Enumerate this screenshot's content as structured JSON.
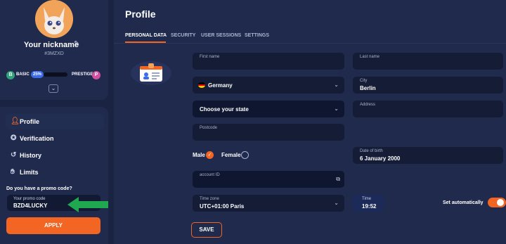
{
  "sidebar": {
    "nickname": "Your nickname",
    "user_id": "#3MZXD",
    "level": {
      "current_badge": "B",
      "current": "BASIC",
      "progress_label": "25%",
      "progress": 0.25,
      "next": "PRESTIGE",
      "next_badge": "P"
    },
    "nav": [
      {
        "label": "Profile",
        "icon": "user-icon",
        "active": true
      },
      {
        "label": "Verification",
        "icon": "verified-icon",
        "active": false
      },
      {
        "label": "History",
        "icon": "history-icon",
        "active": false
      },
      {
        "label": "Limits",
        "icon": "hand-icon",
        "active": false
      }
    ],
    "promo": {
      "question": "Do you have a promo code?",
      "label": "Your promo code",
      "value": "BZD4LUCKY",
      "apply_label": "APPLY"
    }
  },
  "main": {
    "title": "Profile",
    "tabs": [
      {
        "label": "PERSONAL DATA",
        "active": true
      },
      {
        "label": "SECURITY",
        "active": false
      },
      {
        "label": "USER SESSIONS",
        "active": false
      },
      {
        "label": "SETTINGS",
        "active": false
      }
    ],
    "form": {
      "first_name_label": "First name",
      "first_name": "",
      "last_name_label": "Last name",
      "last_name": "",
      "country": "Germany",
      "city_label": "City",
      "city": "Berlin",
      "state_placeholder": "Choose your state",
      "address_label": "Address",
      "address": "",
      "postcode_label": "Postcode",
      "postcode": "",
      "gender_male": "Male",
      "gender_female": "Female",
      "gender_selected": "Male",
      "dob_label": "Date of birth",
      "dob": "6 January 2000",
      "account_id_label": "account ID",
      "account_id": "",
      "timezone_label": "Time zone",
      "timezone": "UTC+01:00 Paris",
      "time_label": "Time",
      "time": "19:52",
      "set_auto_label": "Set automatically",
      "set_auto": true,
      "save_label": "SAVE"
    }
  },
  "colors": {
    "accent": "#f26522",
    "background": "#1a2342",
    "panel": "#1f2a4d",
    "field": "#141c36",
    "arrow": "#1fa84f"
  }
}
